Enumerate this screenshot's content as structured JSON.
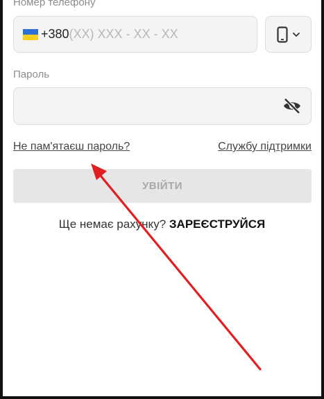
{
  "form": {
    "phone_label": "Номер телефону",
    "phone_prefix": "+380",
    "phone_placeholder": "(XX) XXX - XX - XX",
    "device_icon": "smartphone-icon",
    "password_label": "Пароль",
    "password_value": "",
    "eye_icon": "eye-off-icon",
    "forgot_password": "Не пам'ятаєш пароль?",
    "support_link": "Службу підтримки",
    "login_button": "УВІЙТИ",
    "no_account_text": "Ще немає рахунку?",
    "register_link": "ЗАРЕЄСТРУЙСЯ"
  },
  "colors": {
    "flag_blue": "#2c6fd6",
    "flag_yellow": "#f7cf1e",
    "annotation_arrow": "#e02020"
  }
}
